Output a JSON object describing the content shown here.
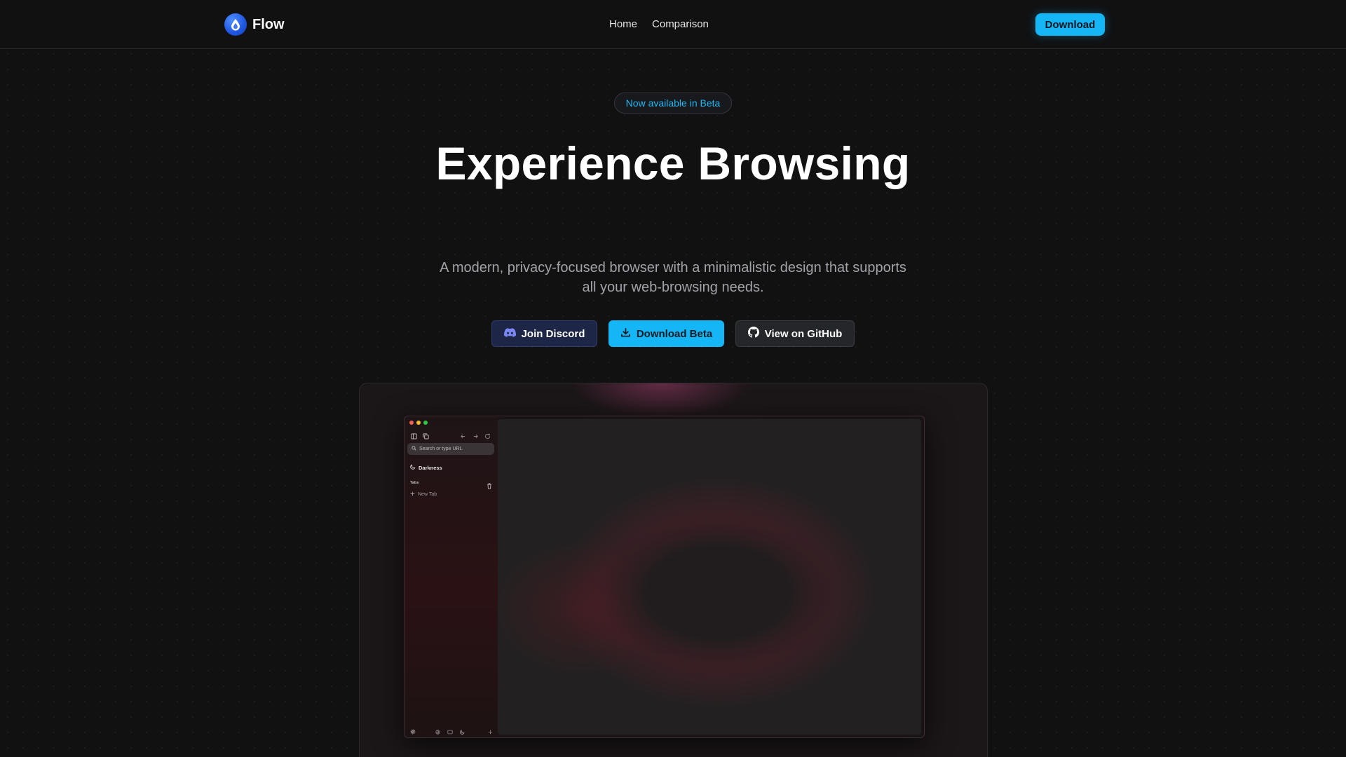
{
  "header": {
    "brand": "Flow",
    "nav": [
      {
        "label": "Home"
      },
      {
        "label": "Comparison"
      }
    ],
    "download_label": "Download"
  },
  "hero": {
    "badge": "Now available in Beta",
    "title": "Experience Browsing",
    "subtitle": "A modern, privacy-focused browser with a minimalistic design that supports all your web-browsing needs.",
    "buttons": {
      "discord": "Join Discord",
      "download_beta": "Download Beta",
      "github": "View on GitHub"
    }
  },
  "preview": {
    "url_placeholder": "Search or type URL",
    "space_name": "Darkness",
    "tabs_label": "Tabs",
    "new_tab_label": "New Tab"
  },
  "colors": {
    "accent": "#14b6f5",
    "background": "#111112",
    "discord_bg": "#1d2646",
    "badge_text": "#22b7f2"
  },
  "icons": [
    "flow-logo-icon",
    "discord-icon",
    "download-icon",
    "github-icon",
    "search-icon",
    "moon-icon",
    "trash-icon",
    "plus-icon"
  ]
}
